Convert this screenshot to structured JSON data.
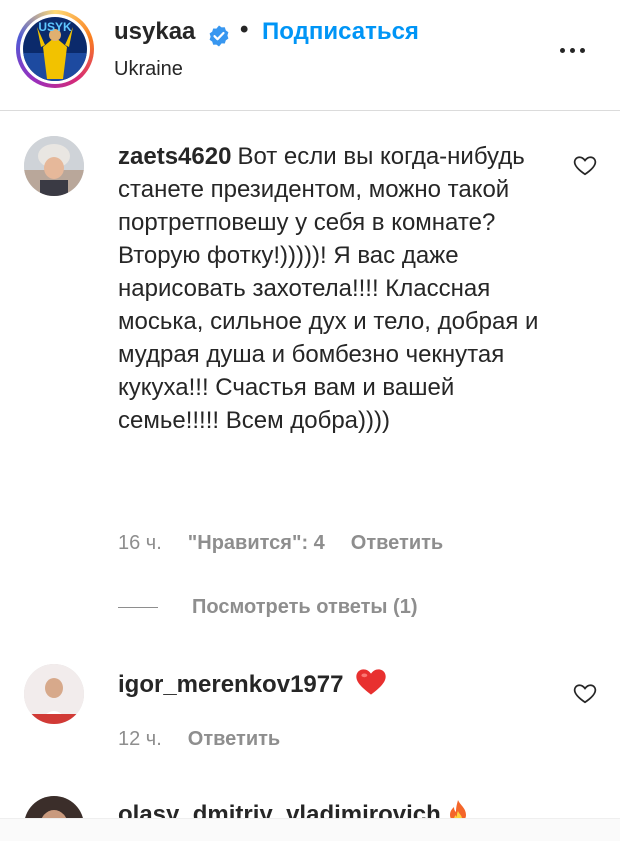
{
  "post_header": {
    "username": "usykaa",
    "separator": "•",
    "follow_label": "Подписаться",
    "location": "Ukraine",
    "avatar_text": "USYK"
  },
  "comments": [
    {
      "username": "zaets4620",
      "text": "Вот если вы когда-нибудь станете президентом, можно такой портретповешу у себя в комнате? Вторую фотку!)))))! Я вас даже нарисовать захотела!!!! Классная моська, сильное дух и тело, добрая и мудрая душа и бомбезно чекнутая кукуха!!! Счастья вам и вашей семье!!!!! Всем добра))))",
      "time": "16 ч.",
      "likes": "\"Нравится\": 4",
      "reply_label": "Ответить",
      "view_replies": "Посмотреть ответы (1)"
    },
    {
      "username": "igor_merenkov1977",
      "text": "",
      "emoji": "heart-emoji",
      "time": "12 ч.",
      "reply_label": "Ответить"
    },
    {
      "username": "olasy_dmitriy_vladimirovich",
      "emoji": "fire-emoji"
    }
  ],
  "colors": {
    "link_blue": "#0095f6",
    "secondary": "#8e8e8e",
    "text": "#262626",
    "heart_red": "#ed4956"
  }
}
